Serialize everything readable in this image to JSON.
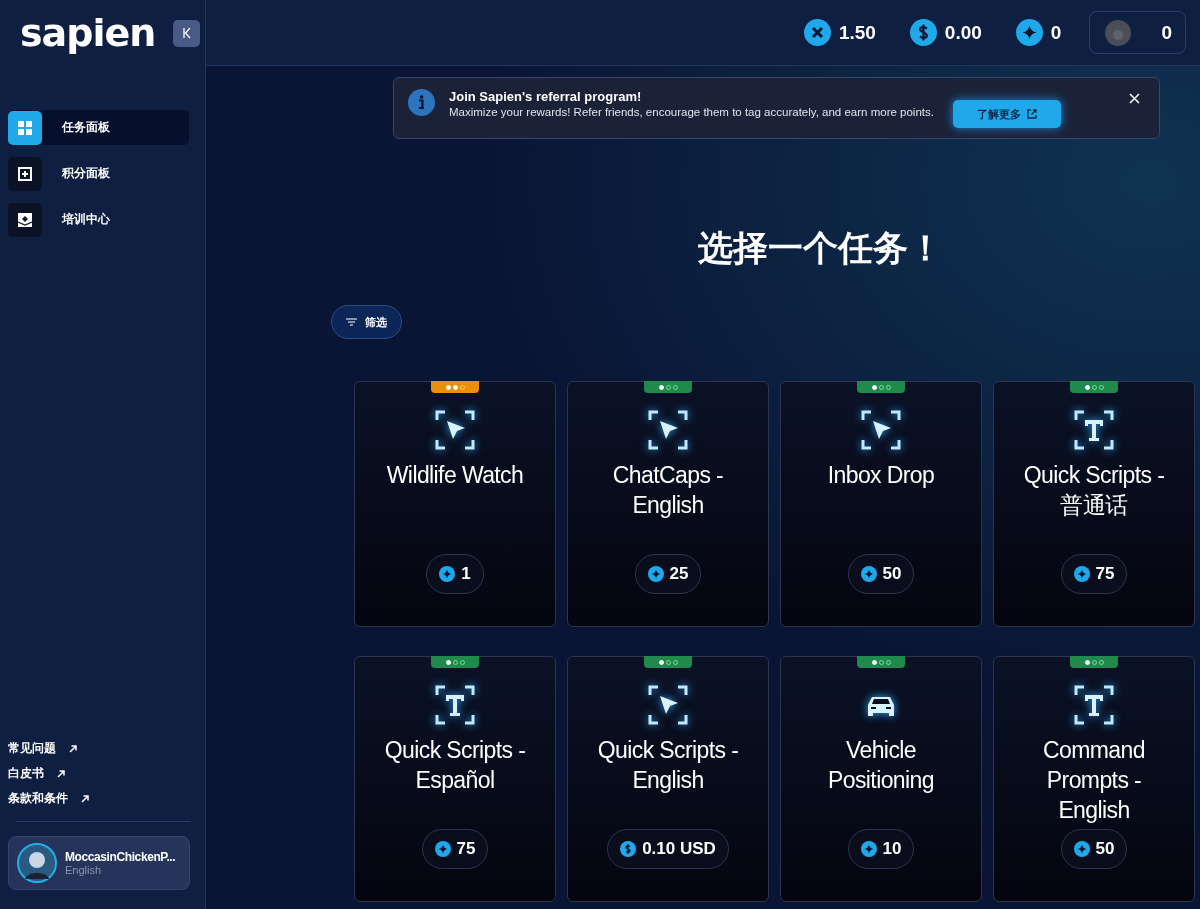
{
  "logo": {
    "text": "sapien"
  },
  "sidebar": {
    "items": [
      {
        "label": "任务面板",
        "selected": true
      },
      {
        "label": "积分面板",
        "selected": false
      },
      {
        "label": "培训中心",
        "selected": false
      }
    ],
    "links": [
      "常见问题",
      "白皮书",
      "条款和条件"
    ],
    "user": {
      "name": "MoccasinChickenP...",
      "language": "English"
    }
  },
  "header": {
    "stats": [
      {
        "kind": "multiplier",
        "value": "1.50"
      },
      {
        "kind": "usd",
        "value": "0.00"
      },
      {
        "kind": "points",
        "value": "0"
      },
      {
        "kind": "avatar",
        "value": "0"
      }
    ]
  },
  "banner": {
    "title": "Join Sapien's referral program!",
    "text": "Maximize your rewards! Refer friends, encourage them to tag accurately, and earn more points.",
    "button": "了解更多"
  },
  "heading": "选择一个任务！",
  "filter": "筛选",
  "tasks": [
    {
      "title": "Wildlife Watch",
      "kind": "pointer",
      "color": "#e8900c",
      "level": 0.67,
      "reward": {
        "kind": "points",
        "value": "1"
      }
    },
    {
      "title": "ChatCaps - English",
      "kind": "pointer",
      "color": "#1f8a4c",
      "level": 0.33,
      "reward": {
        "kind": "points",
        "value": "25"
      }
    },
    {
      "title": "Inbox Drop",
      "kind": "pointer",
      "color": "#1f8a4c",
      "level": 0.33,
      "reward": {
        "kind": "points",
        "value": "50"
      }
    },
    {
      "title": "Quick Scripts - 普通话",
      "kind": "text",
      "color": "#1f8a4c",
      "level": 0.33,
      "reward": {
        "kind": "points",
        "value": "75"
      }
    },
    {
      "title": "Quick Scripts - Español",
      "kind": "text",
      "color": "#1f8a4c",
      "level": 0.33,
      "reward": {
        "kind": "points",
        "value": "75"
      }
    },
    {
      "title": "Quick Scripts - English",
      "kind": "pointer",
      "color": "#1f8a4c",
      "level": 0.33,
      "reward": {
        "kind": "usd",
        "value": "0.10 USD"
      }
    },
    {
      "title": "Vehicle Positioning",
      "kind": "car",
      "color": "#1f8a4c",
      "level": 0.33,
      "reward": {
        "kind": "points",
        "value": "10"
      }
    },
    {
      "title": "Command Prompts - English",
      "kind": "text",
      "color": "#1f8a4c",
      "level": 0.33,
      "reward": {
        "kind": "points",
        "value": "50"
      }
    }
  ]
}
